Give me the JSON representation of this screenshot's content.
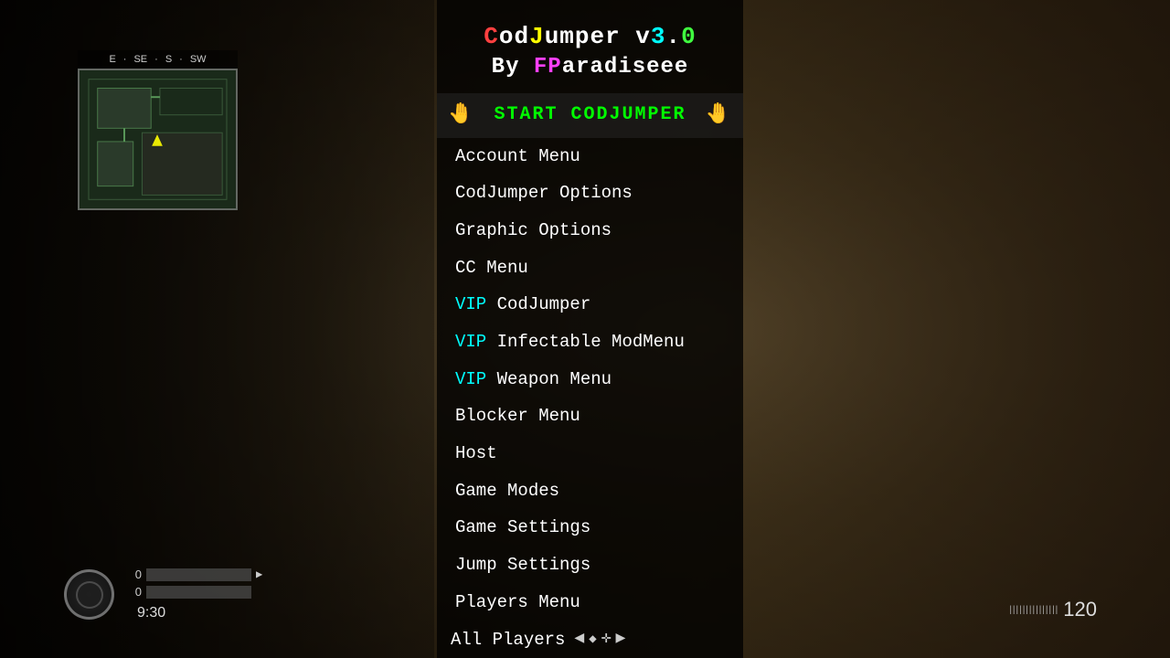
{
  "background": {
    "color": "#2a2010"
  },
  "title": {
    "line1_parts": [
      {
        "text": "C",
        "color": "red"
      },
      {
        "text": "od",
        "color": "white"
      },
      {
        "text": "J",
        "color": "yellow"
      },
      {
        "text": "umper v",
        "color": "white"
      },
      {
        "text": "3",
        "color": "cyan"
      },
      {
        "text": ".",
        "color": "white"
      },
      {
        "text": "0",
        "color": "green"
      }
    ],
    "line2_parts": [
      {
        "text": "B",
        "color": "white"
      },
      {
        "text": "y ",
        "color": "white"
      },
      {
        "text": "FP",
        "color": "pink"
      },
      {
        "text": "aradiseee",
        "color": "white"
      }
    ]
  },
  "compass": {
    "directions": [
      "E",
      "SE",
      "S",
      "SW"
    ]
  },
  "hud": {
    "bar1_value": "0",
    "bar2_value": "0",
    "timer": "9:30"
  },
  "ammo": {
    "dots": "|||||||||||||||",
    "count": "120"
  },
  "menu": {
    "items": [
      {
        "id": "start",
        "type": "start",
        "label": "START CODJUMPER",
        "selected": true
      },
      {
        "id": "account",
        "type": "normal",
        "label": "Account Menu"
      },
      {
        "id": "codjumper-options",
        "type": "normal",
        "label": "CodJumper Options"
      },
      {
        "id": "graphic-options",
        "type": "normal",
        "label": "Graphic Options"
      },
      {
        "id": "cc-menu",
        "type": "normal",
        "label": "CC Menu"
      },
      {
        "id": "vip-codjumper",
        "type": "vip",
        "vip_prefix": "VIP",
        "label": " CodJumper"
      },
      {
        "id": "vip-infectable",
        "type": "vip",
        "vip_prefix": "VIP",
        "label": " Infectable ModMenu"
      },
      {
        "id": "vip-weapon",
        "type": "vip",
        "vip_prefix": "VIP",
        "label": " Weapon Menu"
      },
      {
        "id": "blocker",
        "type": "normal",
        "label": "Blocker Menu"
      },
      {
        "id": "host",
        "type": "normal",
        "label": "Host"
      },
      {
        "id": "game-modes",
        "type": "normal",
        "label": "Game Modes"
      },
      {
        "id": "game-settings",
        "type": "normal",
        "label": "Game Settings"
      },
      {
        "id": "jump-settings",
        "type": "normal",
        "label": "Jump Settings"
      },
      {
        "id": "players-menu",
        "type": "normal",
        "label": "Players Menu"
      },
      {
        "id": "all-players",
        "type": "nav",
        "label": "All Players"
      }
    ]
  }
}
